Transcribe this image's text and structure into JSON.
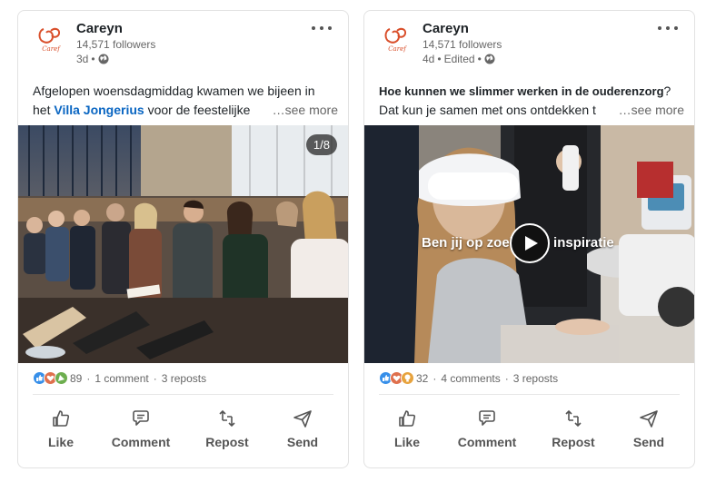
{
  "posts": [
    {
      "author": "Careyn",
      "followers": "14,571 followers",
      "time": "3d",
      "edited": "",
      "text_line1": "Afgelopen woensdagmiddag kwamen we bijeen in",
      "text_line2_prefix": "het ",
      "text_line2_link": "Villa Jongerius",
      "text_line2_rest": " voor de feestelijke",
      "see_more": "…see more",
      "media_counter": "1/8",
      "reactions_count": "89",
      "comments": "1 comment",
      "reposts": "3 reposts",
      "actions": {
        "like": "Like",
        "comment": "Comment",
        "repost": "Repost",
        "send": "Send"
      }
    },
    {
      "author": "Careyn",
      "followers": "14,571 followers",
      "time": "4d",
      "edited": "Edited",
      "text_line1_bold": "Hoe kunnen we slimmer werken in de ouderenzorg",
      "text_line1_rest": "?",
      "text_line2": "Dat kun je samen met ons ontdekken t",
      "see_more": "…see more",
      "video_overlay": "Ben jij op zoek naar inspiratie",
      "reactions_count": "32",
      "comments": "4 comments",
      "reposts": "3 reposts",
      "actions": {
        "like": "Like",
        "comment": "Comment",
        "repost": "Repost",
        "send": "Send"
      }
    }
  ],
  "colors": {
    "link": "#0a66c2",
    "like": "#378fe9",
    "love": "#df704d",
    "celebrate": "#6dae4f",
    "insightful": "#e7a33e"
  },
  "icons": [
    "careyn-logo",
    "globe-icon",
    "more-icon",
    "like-icon",
    "comment-icon",
    "repost-icon",
    "send-icon",
    "play-icon"
  ]
}
